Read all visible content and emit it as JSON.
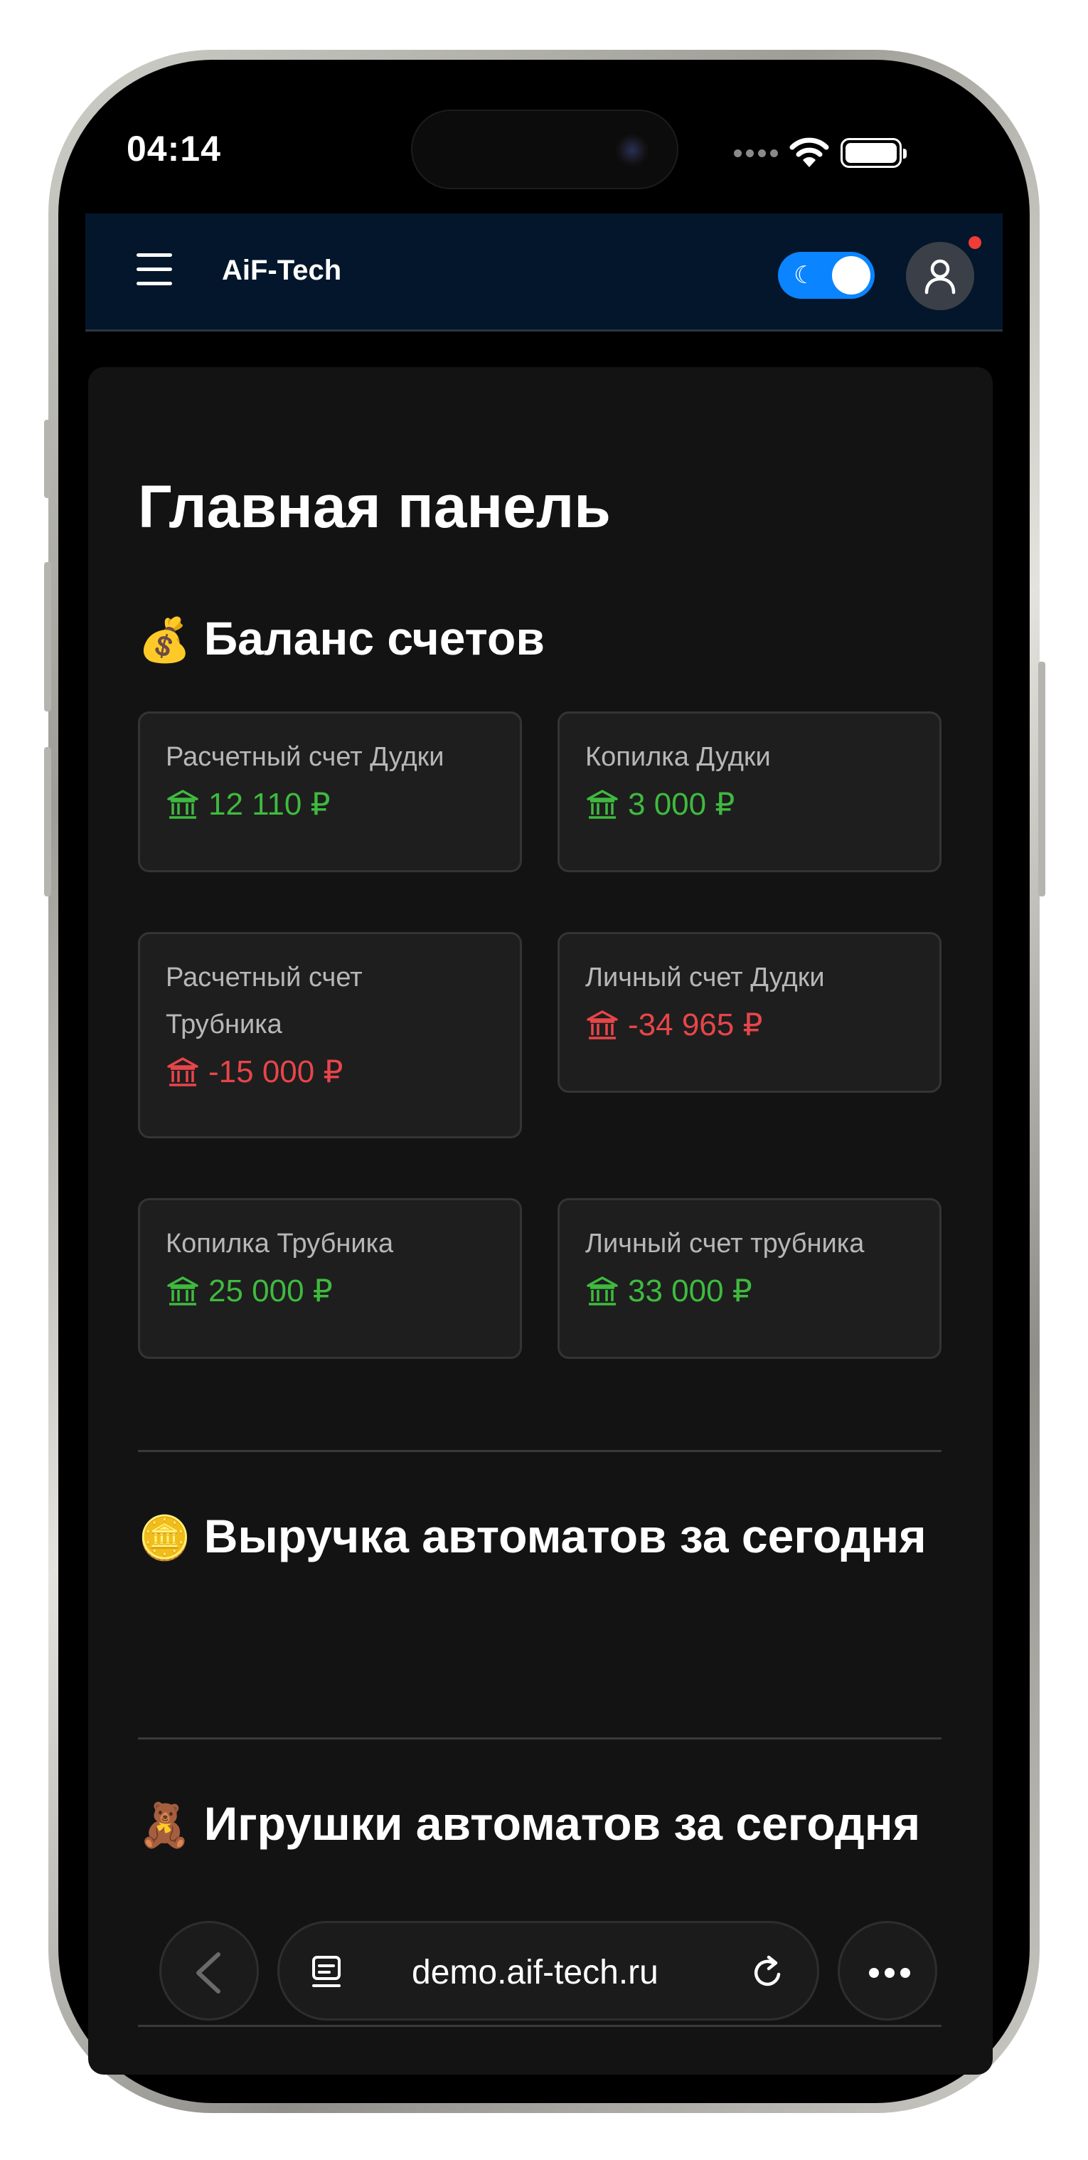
{
  "status_bar": {
    "time": "04:14"
  },
  "header": {
    "brand": "AiF-Tech",
    "theme_toggle": "on"
  },
  "page": {
    "title": "Главная панель"
  },
  "sections": {
    "balances": {
      "emoji": "💰",
      "title": "Баланс счетов"
    },
    "revenue": {
      "emoji": "🪙",
      "title": "Выручка автоматов за сегодня"
    },
    "toys": {
      "emoji": "🧸",
      "title": "Игрушки автоматов за сегодня"
    }
  },
  "accounts": [
    {
      "name": "Расчетный счет Дудки",
      "balance": "12 110 ₽",
      "status": "positive"
    },
    {
      "name": "Копилка Дудки",
      "balance": "3 000 ₽",
      "status": "positive"
    },
    {
      "name": "Расчетный счет Трубника",
      "balance": "-15 000 ₽",
      "status": "negative"
    },
    {
      "name": "Личный счет Дудки",
      "balance": "-34 965 ₽",
      "status": "negative"
    },
    {
      "name": "Копилка Трубника",
      "balance": "25 000 ₽",
      "status": "positive"
    },
    {
      "name": "Личный счет трубника",
      "balance": "33 000 ₽",
      "status": "positive"
    }
  ],
  "browser": {
    "url": "demo.aif-tech.ru"
  },
  "colors": {
    "positive": "#3fba3f",
    "negative": "#e8454a",
    "header_bg": "#03162b",
    "toggle": "#0a84ff"
  },
  "icons": [
    "menu-icon",
    "moon-icon",
    "user-icon",
    "bank-icon",
    "back-icon",
    "tabs-icon",
    "reload-icon",
    "more-icon",
    "wifi-icon",
    "battery-icon"
  ]
}
